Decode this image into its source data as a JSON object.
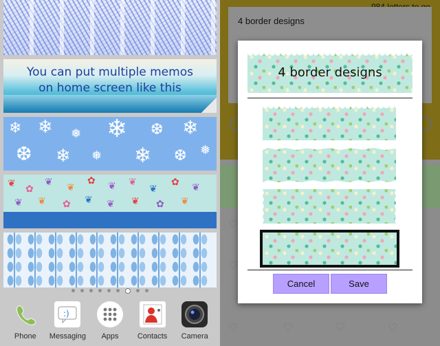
{
  "home": {
    "memo_text": "You can put multiple memos\non home screen like this",
    "memo_line1": "You can put multiple memos",
    "memo_line2": "on home screen like this",
    "page_count": 9,
    "active_page_index": 6,
    "dock": [
      {
        "label": "Phone",
        "icon": "phone-icon"
      },
      {
        "label": "Messaging",
        "icon": "messaging-icon"
      },
      {
        "label": "Apps",
        "icon": "apps-icon"
      },
      {
        "label": "Contacts",
        "icon": "contacts-icon"
      },
      {
        "label": "Camera",
        "icon": "camera-icon"
      }
    ]
  },
  "app": {
    "memo_text": "4 border designs",
    "letters_remaining": "984 letters to go"
  },
  "dialog": {
    "title": "4 border designs",
    "design_count": 4,
    "selected_index": 3,
    "cancel_label": "Cancel",
    "save_label": "Save"
  },
  "colors": {
    "washi_base": "#bfe9df",
    "button_bg": "#b7a0ff",
    "memo_text_color": "#1d3d9e"
  }
}
